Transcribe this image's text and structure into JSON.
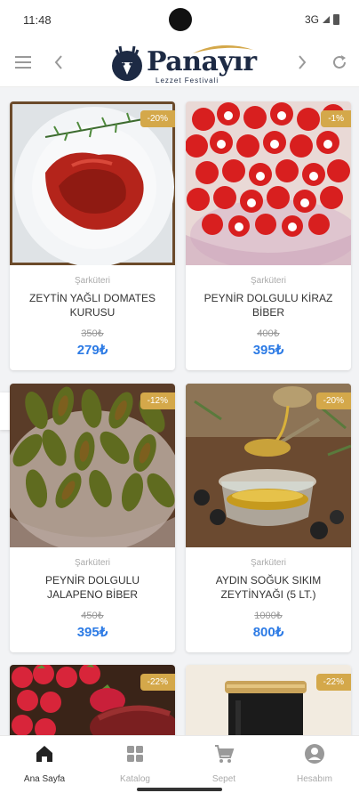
{
  "status": {
    "time": "11:48",
    "network": "3G"
  },
  "brand": {
    "name": "Panayır",
    "tagline": "Lezzet Festivali"
  },
  "colors": {
    "accent": "#2d7be5",
    "badge": "#d4a84a",
    "brand": "#1d2a44"
  },
  "appbar": {
    "icons": [
      "menu-icon",
      "back-icon",
      "forward-icon",
      "refresh-icon"
    ]
  },
  "products": [
    {
      "category": "Şarküteri",
      "title": "ZEYTİN YAĞLI DOMATES KURUSU",
      "old_price": "350₺",
      "price": "279₺",
      "discount": "-20%"
    },
    {
      "category": "Şarküteri",
      "title": "PEYNİR DOLGULU KİRAZ BİBER",
      "old_price": "400₺",
      "price": "395₺",
      "discount": "-1%"
    },
    {
      "category": "Şarküteri",
      "title": "PEYNİR DOLGULU JALAPENO BİBER",
      "old_price": "450₺",
      "price": "395₺",
      "discount": "-12%"
    },
    {
      "category": "Şarküteri",
      "title": "AYDIN SOĞUK SIKIM ZEYTİNYAĞI (5 LT.)",
      "old_price": "1000₺",
      "price": "800₺",
      "discount": "-20%"
    },
    {
      "category": "",
      "title": "",
      "old_price": "",
      "price": "",
      "discount": "-22%"
    },
    {
      "category": "",
      "title": "",
      "old_price": "",
      "price": "",
      "discount": "-22%"
    }
  ],
  "bottom_nav": [
    {
      "label": "Ana Sayfa",
      "icon": "home-icon",
      "active": true
    },
    {
      "label": "Katalog",
      "icon": "grid-icon",
      "active": false
    },
    {
      "label": "Sepet",
      "icon": "cart-icon",
      "active": false
    },
    {
      "label": "Hesabım",
      "icon": "account-icon",
      "active": false
    }
  ]
}
